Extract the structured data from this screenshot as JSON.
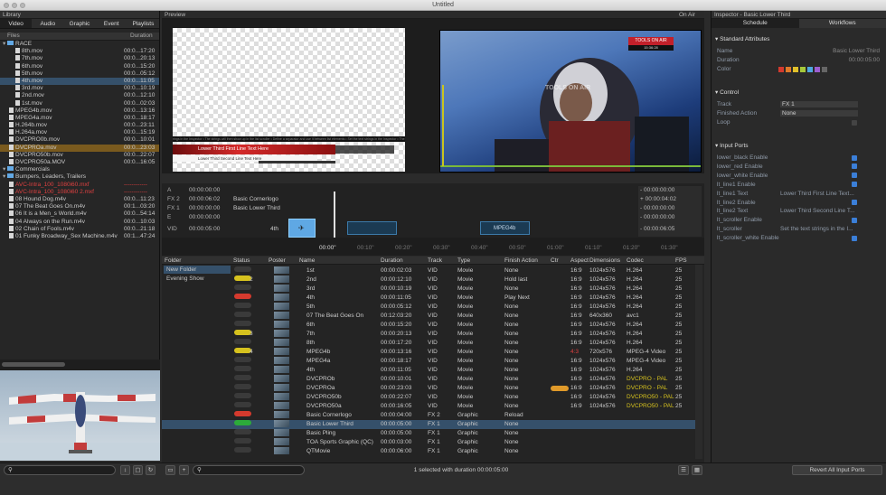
{
  "window": {
    "title": "Untitled"
  },
  "library": {
    "header": "Library",
    "tabs": [
      "Video",
      "Audio",
      "Graphic",
      "Event",
      "Playlists"
    ],
    "col_files": "Files",
    "col_duration": "Duration",
    "files": [
      {
        "name": "RACE",
        "dur": "",
        "indent": 0,
        "type": "folder",
        "state": ""
      },
      {
        "name": "8th.mov",
        "dur": "00:0...17:20",
        "indent": 2,
        "type": "file",
        "state": ""
      },
      {
        "name": "7th.mov",
        "dur": "00:0...20:13",
        "indent": 2,
        "type": "file",
        "state": ""
      },
      {
        "name": "6th.mov",
        "dur": "00:0...15:20",
        "indent": 2,
        "type": "file",
        "state": ""
      },
      {
        "name": "5th.mov",
        "dur": "00:0...05:12",
        "indent": 2,
        "type": "file",
        "state": ""
      },
      {
        "name": "4th.mov",
        "dur": "00:0...11:05",
        "indent": 2,
        "type": "file",
        "state": "sel"
      },
      {
        "name": "3rd.mov",
        "dur": "00:0...10:19",
        "indent": 2,
        "type": "file",
        "state": ""
      },
      {
        "name": "2nd.mov",
        "dur": "00:0...12:10",
        "indent": 2,
        "type": "file",
        "state": ""
      },
      {
        "name": "1st.mov",
        "dur": "00:0...02:03",
        "indent": 2,
        "type": "file",
        "state": ""
      },
      {
        "name": "MPEG4b.mov",
        "dur": "00:0...13:16",
        "indent": 1,
        "type": "file",
        "state": ""
      },
      {
        "name": "MPEG4a.mov",
        "dur": "00:0...18:17",
        "indent": 1,
        "type": "file",
        "state": ""
      },
      {
        "name": "H.264b.mov",
        "dur": "00:0...23:11",
        "indent": 1,
        "type": "file",
        "state": ""
      },
      {
        "name": "H.264a.mov",
        "dur": "00:0...15:19",
        "indent": 1,
        "type": "file",
        "state": ""
      },
      {
        "name": "DVCPRO0b.mov",
        "dur": "00:0...10:01",
        "indent": 1,
        "type": "file",
        "state": ""
      },
      {
        "name": "DVCPROa.mov",
        "dur": "00:0...23:03",
        "indent": 1,
        "type": "file",
        "state": "hl"
      },
      {
        "name": "DVCPRO50b.mov",
        "dur": "00:0...22:07",
        "indent": 1,
        "type": "file",
        "state": ""
      },
      {
        "name": "DVCPRO50a.MOV",
        "dur": "00:0...16:05",
        "indent": 1,
        "type": "file",
        "state": ""
      },
      {
        "name": "Commercials",
        "dur": "",
        "indent": 0,
        "type": "folder",
        "state": ""
      },
      {
        "name": "Bumpers, Leaders, Trailers",
        "dur": "",
        "indent": 0,
        "type": "folder",
        "state": ""
      },
      {
        "name": "AVC-Intra_100_1080i60.mxf",
        "dur": "------------",
        "indent": 1,
        "type": "file",
        "state": "red"
      },
      {
        "name": "AVC-Intra_100_1080i60 2.mxf",
        "dur": "------------",
        "indent": 1,
        "type": "file",
        "state": "red"
      },
      {
        "name": "08 Hound Dog.m4v",
        "dur": "00:0...11:23",
        "indent": 1,
        "type": "file",
        "state": ""
      },
      {
        "name": "07 The Beat Goes On.m4v",
        "dur": "00:1...03:20",
        "indent": 1,
        "type": "file",
        "state": ""
      },
      {
        "name": "06 It is a Men_s World.m4v",
        "dur": "00:0...54:14",
        "indent": 1,
        "type": "file",
        "state": ""
      },
      {
        "name": "04 Always on the Run.m4v",
        "dur": "00:0...10:03",
        "indent": 1,
        "type": "file",
        "state": ""
      },
      {
        "name": "02 Chain of Fools.m4v",
        "dur": "00:0...21:18",
        "indent": 1,
        "type": "file",
        "state": ""
      },
      {
        "name": "01 Funky Broadway_Sex Machine.m4v",
        "dur": "00:1...47:24",
        "indent": 1,
        "type": "file",
        "state": ""
      }
    ]
  },
  "preview": {
    "label": "Preview",
    "on_air": "On Air",
    "lt_line1": "Lower Third First Line Text Here",
    "lt_line2": "Lower Third Second Line Text Here",
    "ticker": "rings in the Inspector  •  The strings will then show up in the list scroller  •  Define a separator and use it between list elements  •  Set the text strings in the Inspector  •  The stri",
    "bug_text": "TOOLS ON AIR",
    "bug_time": "15:36:28",
    "watermark": "TOOLS ON AIR"
  },
  "timeline": {
    "tracks": [
      {
        "label": "A",
        "tc": "00:00:00:00",
        "name": "",
        "rtc": "- 00:00:00:00"
      },
      {
        "label": "FX 2",
        "tc": "00:00:06:02",
        "name": "Basic Cornerlogo",
        "rtc": "+ 00:00:04:02"
      },
      {
        "label": "FX 1",
        "tc": "00:00:00:00",
        "name": "Basic Lower Third",
        "rtc": "- 00:00:00:00"
      },
      {
        "label": "E",
        "tc": "00:00:00:00",
        "name": "",
        "rtc": "- 00:00:00:00"
      },
      {
        "label": "VID",
        "tc": "00:00:05:00",
        "name": "",
        "rtc": "- 00:00:06:05"
      }
    ],
    "vid_pct": "4th",
    "clip2": "MPEG4b",
    "ruler": [
      "00:00\"",
      "00:10\"",
      "00:20\"",
      "00:30\"",
      "00:40\"",
      "00:50\"",
      "01:00\"",
      "01:10\"",
      "01:20\"",
      "01:30\""
    ]
  },
  "playlist": {
    "cols": [
      "Folder",
      "Status",
      "Poster",
      "Name",
      "Duration",
      "Track",
      "Type",
      "Finish Action",
      "Ctr",
      "Aspect",
      "Dimensions",
      "Codec",
      "FPS"
    ],
    "folders": [
      "New Folder",
      "Evening Show"
    ],
    "rows": [
      {
        "st": "",
        "num": "",
        "name": "1st",
        "dur": "00:00:02:03",
        "track": "VID",
        "type": "Movie",
        "finish": "None",
        "ctr": "",
        "aspect": "16:9",
        "dim": "1024x576",
        "codec": "H.264",
        "fps": "25"
      },
      {
        "st": "y",
        "num": "2",
        "name": "2nd",
        "dur": "00:00:12:10",
        "track": "VID",
        "type": "Movie",
        "finish": "Hold last",
        "ctr": "",
        "aspect": "16:9",
        "dim": "1024x576",
        "codec": "H.264",
        "fps": "25"
      },
      {
        "st": "",
        "num": "",
        "name": "3rd",
        "dur": "00:00:10:19",
        "track": "VID",
        "type": "Movie",
        "finish": "None",
        "ctr": "",
        "aspect": "16:9",
        "dim": "1024x576",
        "codec": "H.264",
        "fps": "25"
      },
      {
        "st": "r",
        "num": "",
        "name": "4th",
        "dur": "00:00:11:05",
        "track": "VID",
        "type": "Movie",
        "finish": "Play Next",
        "ctr": "",
        "aspect": "16:9",
        "dim": "1024x576",
        "codec": "H.264",
        "fps": "25"
      },
      {
        "st": "",
        "num": "",
        "name": "5th",
        "dur": "00:00:05:12",
        "track": "VID",
        "type": "Movie",
        "finish": "None",
        "ctr": "",
        "aspect": "16:9",
        "dim": "1024x576",
        "codec": "H.264",
        "fps": "25"
      },
      {
        "st": "",
        "num": "",
        "name": "07 The Beat Goes On",
        "dur": "00:12:03:20",
        "track": "VID",
        "type": "Movie",
        "finish": "None",
        "ctr": "",
        "aspect": "16:9",
        "dim": "640x360",
        "codec": "avc1",
        "fps": "25"
      },
      {
        "st": "",
        "num": "",
        "name": "6th",
        "dur": "00:00:15:20",
        "track": "VID",
        "type": "Movie",
        "finish": "None",
        "ctr": "",
        "aspect": "16:9",
        "dim": "1024x576",
        "codec": "H.264",
        "fps": "25"
      },
      {
        "st": "y",
        "num": "3",
        "name": "7th",
        "dur": "00:00:20:13",
        "track": "VID",
        "type": "Movie",
        "finish": "None",
        "ctr": "",
        "aspect": "16:9",
        "dim": "1024x576",
        "codec": "H.264",
        "fps": "25"
      },
      {
        "st": "",
        "num": "",
        "name": "8th",
        "dur": "00:00:17:20",
        "track": "VID",
        "type": "Movie",
        "finish": "None",
        "ctr": "",
        "aspect": "16:9",
        "dim": "1024x576",
        "codec": "H.264",
        "fps": "25"
      },
      {
        "st": "y",
        "num": "4",
        "name": "MPEG4b",
        "dur": "00:00:13:16",
        "track": "VID",
        "type": "Movie",
        "finish": "None",
        "ctr": "",
        "aspect": "4:3",
        "dim": "720x576",
        "codec": "MPEG-4 Video",
        "fps": "25"
      },
      {
        "st": "",
        "num": "",
        "name": "MPEG4a",
        "dur": "00:00:18:17",
        "track": "VID",
        "type": "Movie",
        "finish": "None",
        "ctr": "",
        "aspect": "16:9",
        "dim": "1024x576",
        "codec": "MPEG-4 Video",
        "fps": "25"
      },
      {
        "st": "",
        "num": "",
        "name": "4th",
        "dur": "00:00:11:05",
        "track": "VID",
        "type": "Movie",
        "finish": "None",
        "ctr": "",
        "aspect": "16:9",
        "dim": "1024x576",
        "codec": "H.264",
        "fps": "25"
      },
      {
        "st": "",
        "num": "",
        "name": "DVCPROb",
        "dur": "00:00:10:01",
        "track": "VID",
        "type": "Movie",
        "finish": "None",
        "ctr": "",
        "aspect": "16:9",
        "dim": "1024x576",
        "codec": "DVCPRO - PAL",
        "fps": "25"
      },
      {
        "st": "",
        "num": "",
        "name": "DVCPROa",
        "dur": "00:00:23:03",
        "track": "VID",
        "type": "Movie",
        "finish": "None",
        "ctr": "o",
        "aspect": "16:9",
        "dim": "1024x576",
        "codec": "DVCPRO - PAL",
        "fps": "25"
      },
      {
        "st": "",
        "num": "",
        "name": "DVCPRO50b",
        "dur": "00:00:22:07",
        "track": "VID",
        "type": "Movie",
        "finish": "None",
        "ctr": "",
        "aspect": "16:9",
        "dim": "1024x576",
        "codec": "DVCPRO50 - PAL",
        "fps": "25"
      },
      {
        "st": "",
        "num": "",
        "name": "DVCPRO50a",
        "dur": "00:00:16:05",
        "track": "VID",
        "type": "Movie",
        "finish": "None",
        "ctr": "",
        "aspect": "16:9",
        "dim": "1024x576",
        "codec": "DVCPRO50 - PAL",
        "fps": "25"
      },
      {
        "st": "rp",
        "num": "",
        "name": "Basic Cornerlogo",
        "dur": "00:00:04:00",
        "track": "FX 2",
        "type": "Graphic",
        "finish": "Reload",
        "ctr": "",
        "aspect": "",
        "dim": "",
        "codec": "",
        "fps": ""
      },
      {
        "st": "g",
        "num": "",
        "name": "Basic Lower Third",
        "dur": "00:00:05:00",
        "track": "FX 1",
        "type": "Graphic",
        "finish": "None",
        "ctr": "",
        "aspect": "",
        "dim": "",
        "codec": "",
        "fps": "",
        "sel": true
      },
      {
        "st": "",
        "num": "",
        "name": "Basic Pling",
        "dur": "00:00:05:00",
        "track": "FX 1",
        "type": "Graphic",
        "finish": "None",
        "ctr": "",
        "aspect": "",
        "dim": "",
        "codec": "",
        "fps": ""
      },
      {
        "st": "",
        "num": "",
        "name": "TOA Sports Graphic (QC)",
        "dur": "00:00:03:00",
        "track": "FX 1",
        "type": "Graphic",
        "finish": "None",
        "ctr": "",
        "aspect": "",
        "dim": "",
        "codec": "",
        "fps": ""
      },
      {
        "st": "",
        "num": "",
        "name": "QTMovie",
        "dur": "00:00:06:00",
        "track": "FX 1",
        "type": "Graphic",
        "finish": "None",
        "ctr": "",
        "aspect": "",
        "dim": "",
        "codec": "",
        "fps": ""
      }
    ]
  },
  "inspector": {
    "title": "Inspector - Basic Lower Third",
    "tabs": [
      "Schedule",
      "Workflows"
    ],
    "sec_attrs": "Standard Attributes",
    "name_label": "Name",
    "name_val": "Basic Lower Third",
    "dur_label": "Duration",
    "dur_val": "00:00:05:00",
    "color_label": "Color",
    "sec_control": "Control",
    "track_label": "Track",
    "track_val": "FX 1",
    "finish_label": "Finished Action",
    "finish_val": "None",
    "loop_label": "Loop",
    "sec_ports": "Input Ports",
    "ports": [
      {
        "label": "lower_black Enable",
        "val": "",
        "chk": true
      },
      {
        "label": "lower_red Enable",
        "val": "",
        "chk": true
      },
      {
        "label": "lower_white Enable",
        "val": "",
        "chk": true
      },
      {
        "label": "lt_line1 Enable",
        "val": "",
        "chk": true
      },
      {
        "label": "lt_line1 Text",
        "val": "Lower Third First Line Text...",
        "chk": null
      },
      {
        "label": "lt_line2 Enable",
        "val": "",
        "chk": true
      },
      {
        "label": "lt_line2 Text",
        "val": "Lower Third Second Line T...",
        "chk": null
      },
      {
        "label": "lt_scroller Enable",
        "val": "",
        "chk": true
      },
      {
        "label": "lt_scroller",
        "val": "Set the text strings in the I...",
        "chk": null
      },
      {
        "label": "lt_scroller_white Enable",
        "val": "",
        "chk": true
      }
    ],
    "swatches": [
      "#d43a2e",
      "#e07a2a",
      "#e0c02a",
      "#a6c83a",
      "#4ea8e0",
      "#9c5ed0",
      "#666666"
    ]
  },
  "bottom": {
    "status": "1 selected with duration 00:00:05:00",
    "revert": "Revert All Input Ports"
  }
}
